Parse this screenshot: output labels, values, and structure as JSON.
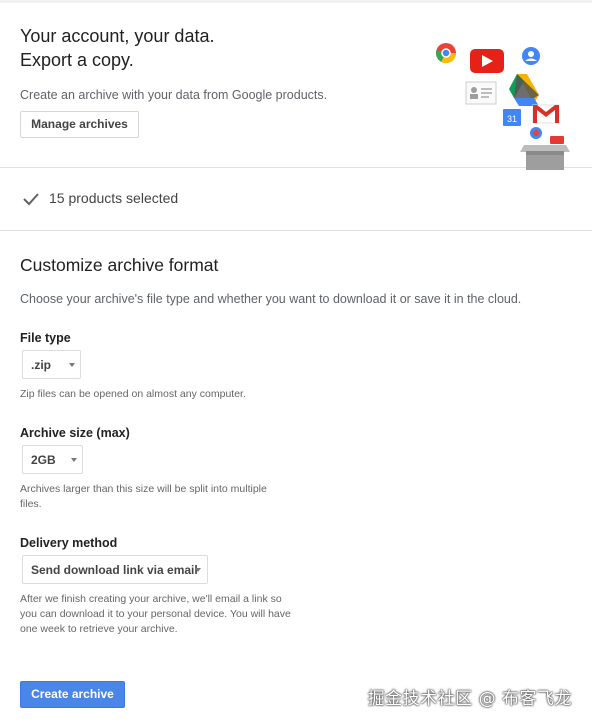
{
  "hero": {
    "title_line1": "Your account, your data.",
    "title_line2": "Export a copy.",
    "subtitle": "Create an archive with your data from Google products.",
    "manage_button": "Manage archives",
    "art_icons": [
      "chrome-icon",
      "youtube-icon",
      "contacts-icon",
      "profile-card-icon",
      "drive-icon",
      "gmail-icon",
      "calendar-icon",
      "box-icon"
    ],
    "calendar_day": "31"
  },
  "products": {
    "selected_text": "15 products selected"
  },
  "customize": {
    "title": "Customize archive format",
    "description": "Choose your archive's file type and whether you want to download it or save it in the cloud.",
    "file_type": {
      "label": "File type",
      "value": ".zip",
      "help": "Zip files can be opened on almost any computer."
    },
    "archive_size": {
      "label": "Archive size (max)",
      "value": "2GB",
      "help": "Archives larger than this size will be split into multiple files."
    },
    "delivery": {
      "label": "Delivery method",
      "value": "Send download link via email",
      "help": "After we finish creating your archive, we'll email a link so you can download it to your personal device. You will have one week to retrieve your archive."
    },
    "create_button": "Create archive"
  },
  "watermark": "掘金技术社区 @ 布客飞龙",
  "colors": {
    "primary_button": "#4a86e8",
    "youtube": "#e62117",
    "gmail": "#d93025",
    "drive_yellow": "#f4b400",
    "drive_green": "#0f9d58",
    "drive_blue": "#4285f4"
  }
}
